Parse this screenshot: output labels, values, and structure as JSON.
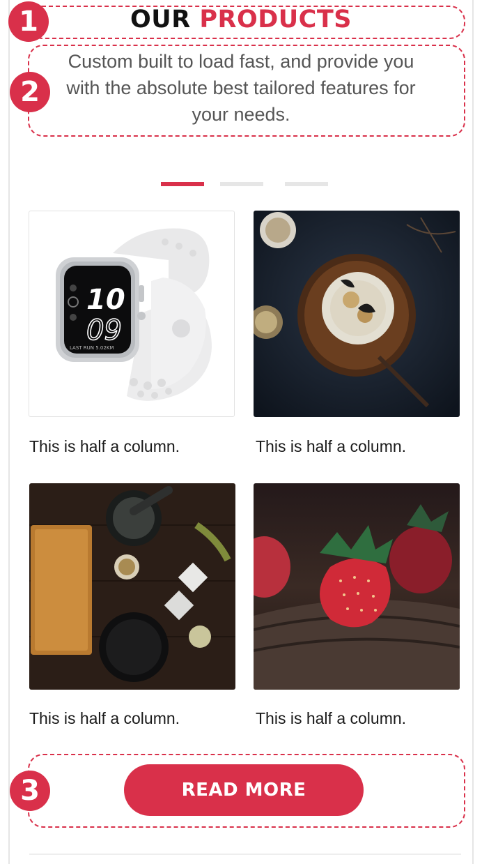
{
  "header": {
    "title_part1": "OUR",
    "title_part2": "PRODUCTS",
    "subtitle_line1": "Custom built to load fast, and provide you",
    "subtitle_line2": "with the absolute best tailored features for",
    "subtitle_line3": "your needs."
  },
  "markers": [
    "1",
    "2",
    "3"
  ],
  "carousel": {
    "count": 3,
    "active_index": 0
  },
  "cards": [
    {
      "image": "smartwatch-image",
      "watch_hour": "10",
      "watch_min": "09",
      "watch_info": "LAST RUN 5.02KM",
      "caption": "This is half a column."
    },
    {
      "image": "dessert-image",
      "caption": "This is half a column."
    },
    {
      "image": "kitchen-tools-image",
      "caption": "This is half a column."
    },
    {
      "image": "strawberries-image",
      "caption": "This is half a column."
    }
  ],
  "cta": {
    "label": "READ MORE"
  },
  "colors": {
    "accent": "#d9304a",
    "text": "#111111",
    "muted": "#555555"
  }
}
